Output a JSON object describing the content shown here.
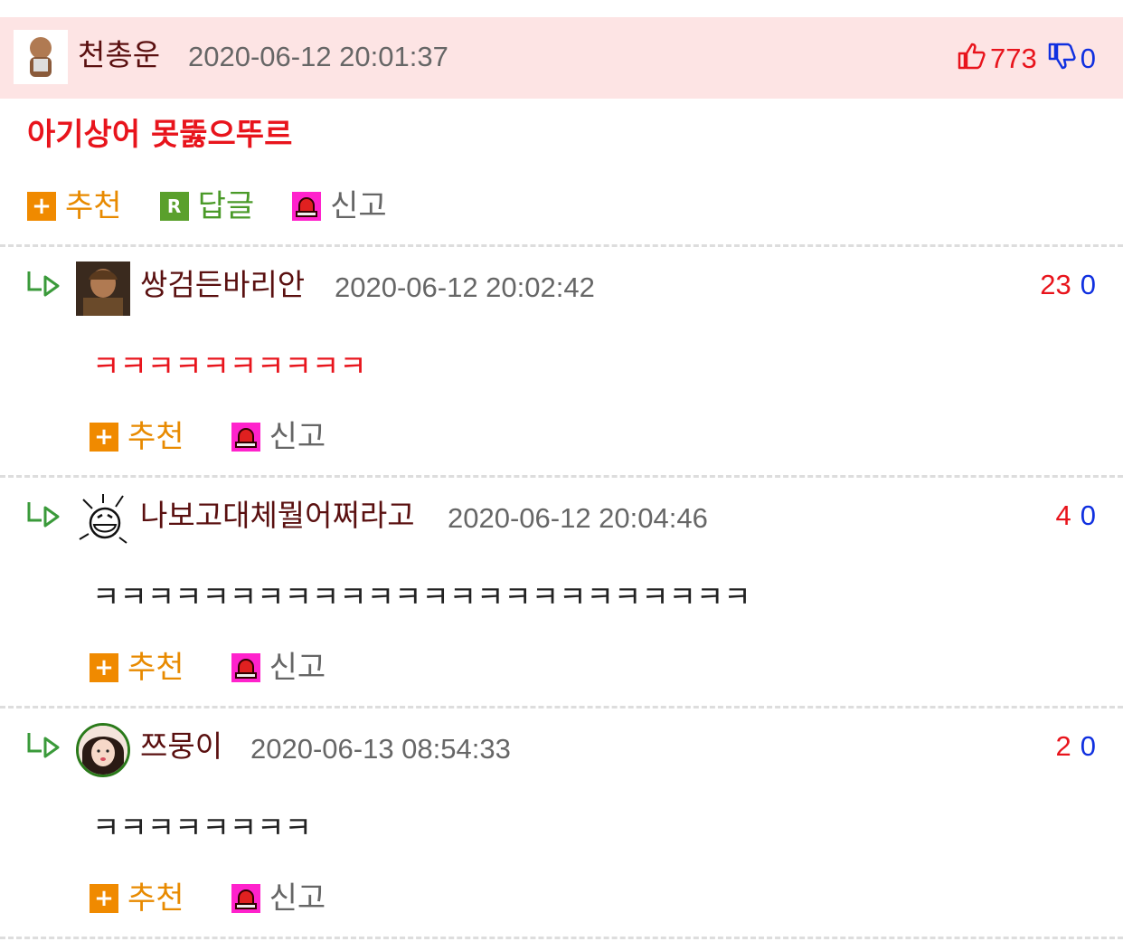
{
  "best_comment": {
    "nickname": "천총운",
    "date": "2020-06-12 20:01:37",
    "upvotes": "773",
    "downvotes": "0",
    "text": "아기상어 못뚫으뚜르",
    "actions": {
      "recommend": "추천",
      "reply": "답글",
      "report": "신고"
    }
  },
  "replies": [
    {
      "nickname": "쌍검든바리안",
      "date": "2020-06-12 20:02:42",
      "upvotes": "23",
      "downvotes": "0",
      "text": "ㅋㅋㅋㅋㅋㅋㅋㅋㅋㅋ",
      "recommend": "추천",
      "report": "신고"
    },
    {
      "nickname": "나보고대체뭘어쩌라고",
      "date": "2020-06-12 20:04:46",
      "upvotes": "4",
      "downvotes": "0",
      "text": "ㅋㅋㅋㅋㅋㅋㅋㅋㅋㅋㅋㅋㅋㅋㅋㅋㅋㅋㅋㅋㅋㅋㅋㅋ",
      "recommend": "추천",
      "report": "신고"
    },
    {
      "nickname": "쯔뭉이",
      "date": "2020-06-13 08:54:33",
      "upvotes": "2",
      "downvotes": "0",
      "text": "ㅋㅋㅋㅋㅋㅋㅋㅋ",
      "recommend": "추천",
      "report": "신고"
    }
  ],
  "colors": {
    "best_bg": "#fde4e4",
    "up": "#e8141c",
    "down": "#1030e0",
    "recommend": "#e88a00",
    "reply": "#4a9a28",
    "best_text": "#e8141c"
  }
}
